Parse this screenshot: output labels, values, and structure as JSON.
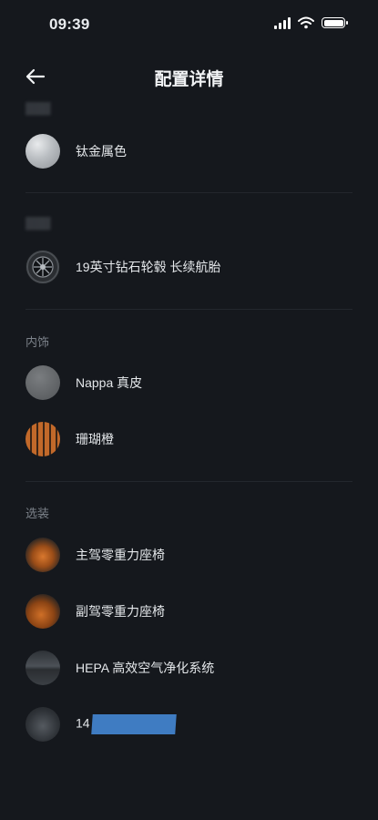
{
  "status_bar": {
    "time": "09:39"
  },
  "header": {
    "title": "配置详情"
  },
  "sections": [
    {
      "label": "",
      "items": [
        {
          "label": "钛金属色",
          "thumb": "titanium-swatch"
        }
      ]
    },
    {
      "label": "",
      "items": [
        {
          "label": "19英寸钻石轮毂 长续航胎",
          "thumb": "wheel-icon"
        }
      ]
    },
    {
      "label": "内饰",
      "items": [
        {
          "label": "Nappa 真皮",
          "thumb": "nappa-swatch"
        },
        {
          "label": "珊瑚橙",
          "thumb": "coral-orange-swatch"
        }
      ]
    },
    {
      "label": "选装",
      "items": [
        {
          "label": "主驾零重力座椅",
          "thumb": "driver-seat-image"
        },
        {
          "label": "副驾零重力座椅",
          "thumb": "passenger-seat-image"
        },
        {
          "label": "HEPA 高效空气净化系统",
          "thumb": "air-filter-image"
        },
        {
          "label": "14",
          "thumb": "car-image",
          "redacted": true
        }
      ]
    }
  ],
  "colors": {
    "background": "#15181d",
    "redaction": "#3f7cc2",
    "section_label": "#7c828a"
  }
}
